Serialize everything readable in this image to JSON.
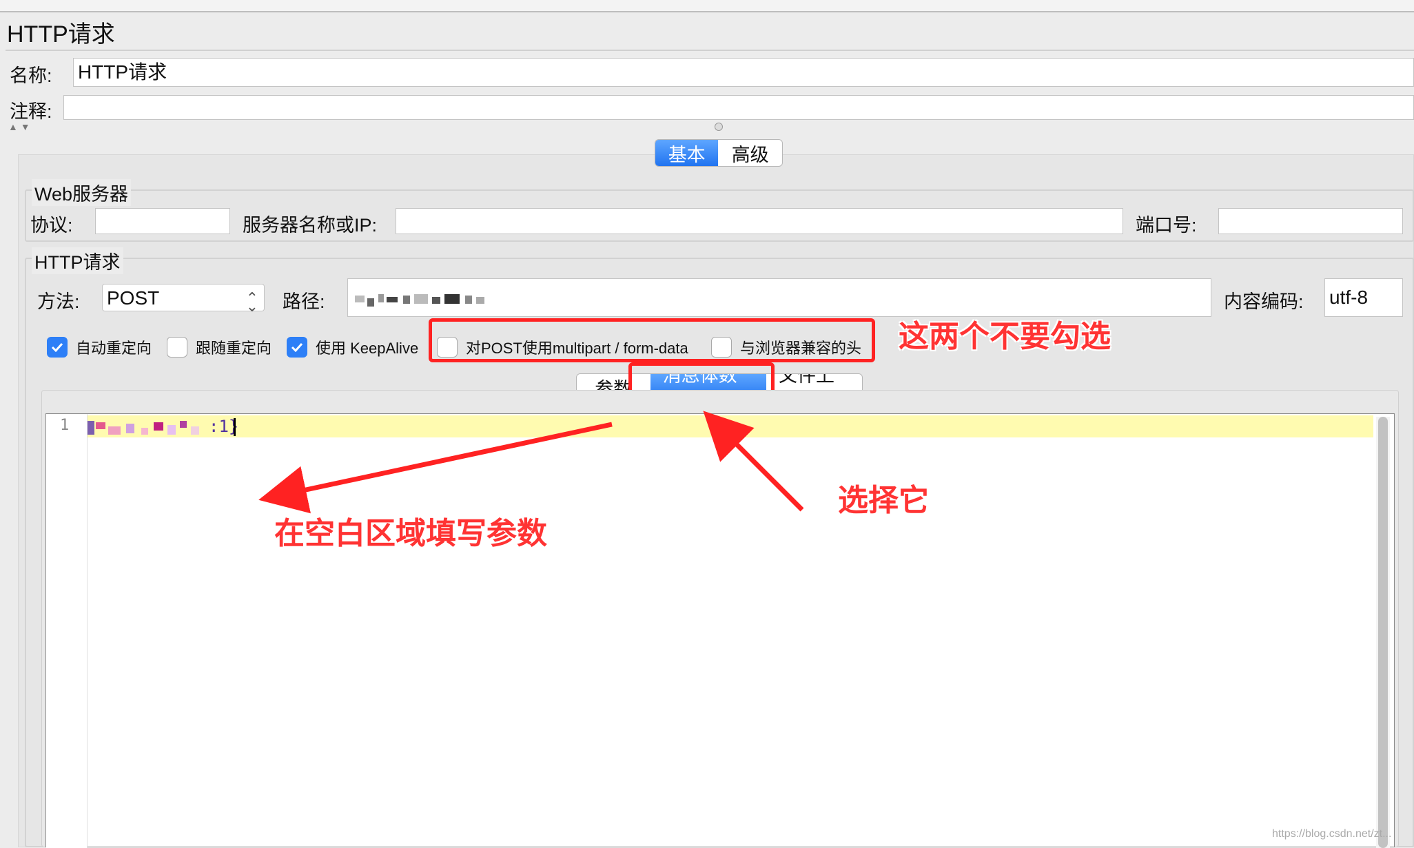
{
  "panel_title": "HTTP请求",
  "name_label": "名称:",
  "name_value": "HTTP请求",
  "comment_label": "注释:",
  "comment_value": "",
  "tabs": {
    "basic": "基本",
    "advanced": "高级"
  },
  "web_server": {
    "legend": "Web服务器",
    "protocol_label": "协议:",
    "protocol_value": "",
    "server_label": "服务器名称或IP:",
    "server_value": "",
    "port_label": "端口号:",
    "port_value": ""
  },
  "http_request": {
    "legend": "HTTP请求",
    "method_label": "方法:",
    "method_value": "POST",
    "path_label": "路径:",
    "path_value": "",
    "encoding_label": "内容编码:",
    "encoding_value": "utf-8"
  },
  "checkboxes": [
    {
      "label": "自动重定向",
      "checked": true
    },
    {
      "label": "跟随重定向",
      "checked": false
    },
    {
      "label": "使用 KeepAlive",
      "checked": true
    },
    {
      "label": "对POST使用multipart / form-data",
      "checked": false
    },
    {
      "label": "与浏览器兼容的头",
      "checked": false
    }
  ],
  "body_tabs": {
    "params": "参数",
    "body_data": "消息体数据",
    "file_upload": "文件上传"
  },
  "editor": {
    "line_number": "1",
    "text_suffix": ":1}"
  },
  "annotations": {
    "dont_check": "这两个不要勾选",
    "select_it": "选择它",
    "fill_params": "在空白区域填写参数"
  },
  "watermark": "https://blog.csdn.net/zt..."
}
